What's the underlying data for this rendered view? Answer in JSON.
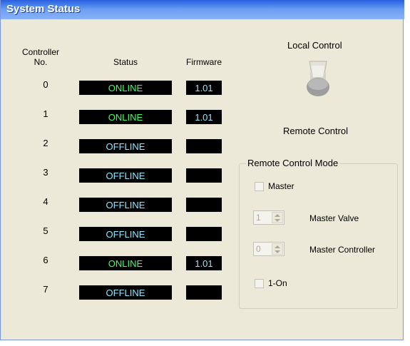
{
  "window": {
    "title": "System Status"
  },
  "headers": {
    "controller_no": "Controller\nNo.",
    "status": "Status",
    "firmware": "Firmware"
  },
  "rows": [
    {
      "no": "0",
      "status": "ONLINE",
      "state": "online",
      "firmware": "1.01"
    },
    {
      "no": "1",
      "status": "ONLINE",
      "state": "online",
      "firmware": "1.01"
    },
    {
      "no": "2",
      "status": "OFFLINE",
      "state": "offline",
      "firmware": ""
    },
    {
      "no": "3",
      "status": "OFFLINE",
      "state": "offline",
      "firmware": ""
    },
    {
      "no": "4",
      "status": "OFFLINE",
      "state": "offline",
      "firmware": ""
    },
    {
      "no": "5",
      "status": "OFFLINE",
      "state": "offline",
      "firmware": ""
    },
    {
      "no": "6",
      "status": "ONLINE",
      "state": "online",
      "firmware": "1.01"
    },
    {
      "no": "7",
      "status": "OFFLINE",
      "state": "offline",
      "firmware": ""
    }
  ],
  "control": {
    "local_label": "Local Control",
    "remote_label": "Remote Control"
  },
  "remote_mode": {
    "title": "Remote Control Mode",
    "master_checkbox": "Master",
    "master_valve_value": "1",
    "master_valve_label": "Master Valve",
    "master_controller_value": "0",
    "master_controller_label": "Master Controller",
    "one_on_checkbox": "1-On"
  },
  "colors": {
    "online": "#3dff60",
    "offline": "#8fe7ff",
    "title_bar": "#3f7ae9"
  }
}
